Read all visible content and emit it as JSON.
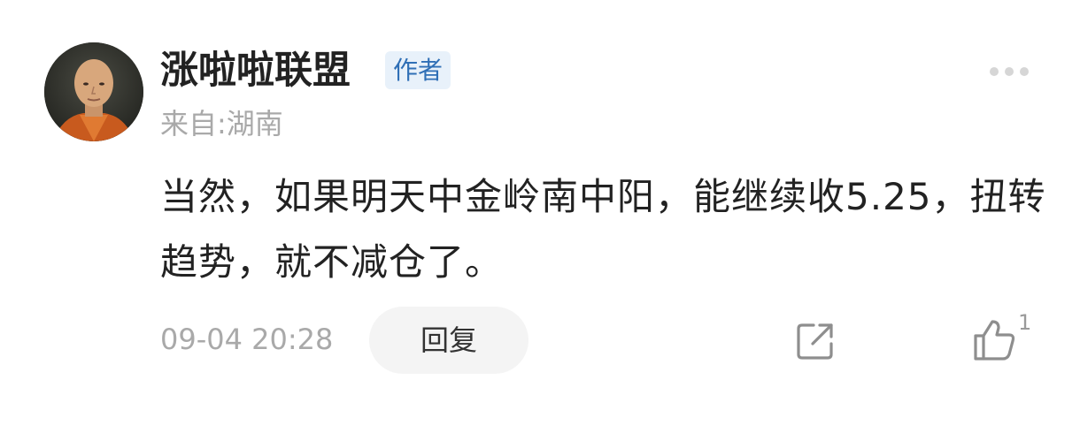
{
  "comment": {
    "author": {
      "name": "涨啦啦联盟",
      "badge": "作者",
      "location": "来自:湖南"
    },
    "text": "当然，如果明天中金岭南中阳，能继续收5.25，扭转趋势，就不减仓了。",
    "timestamp": "09-04 20:28",
    "reply_label": "回复",
    "like_count": "1",
    "icons": {
      "more": "more-dots-icon",
      "share": "share-external-icon",
      "like": "thumbs-up-icon"
    },
    "colors": {
      "badge_bg": "#e8f1fa",
      "badge_text": "#2f6fb6",
      "muted_text": "#a9a9a9",
      "primary_text": "#222222"
    }
  }
}
